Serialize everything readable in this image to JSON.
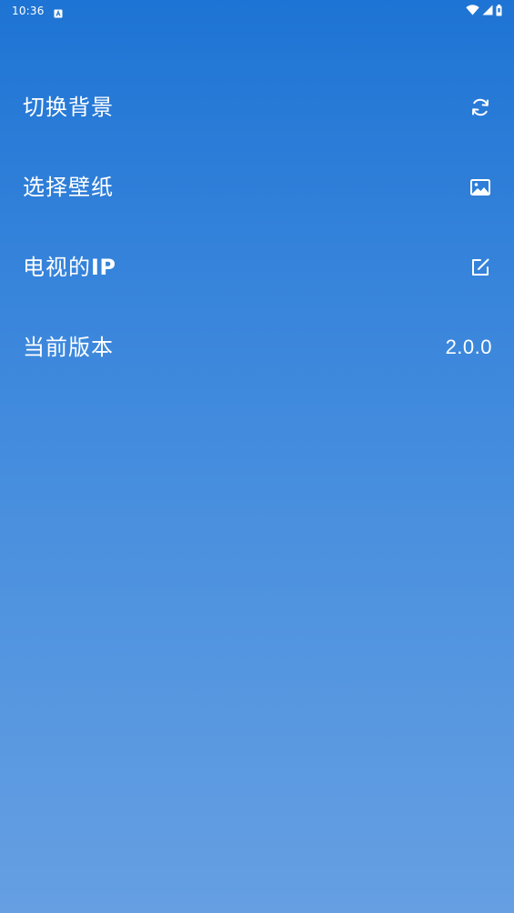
{
  "status_bar": {
    "time": "10:36",
    "notification_icon": "keyboard-a-icon",
    "wifi_icon": "wifi-icon",
    "signal_icon": "cell-signal-icon",
    "battery_icon": "battery-icon"
  },
  "settings": {
    "items": [
      {
        "label": "切换背景",
        "icon": "refresh-icon"
      },
      {
        "label": "选择壁纸",
        "icon": "image-icon"
      },
      {
        "label_prefix": "电视的",
        "label_suffix": "IP",
        "icon": "edit-icon"
      },
      {
        "label": "当前版本",
        "value": "2.0.0"
      }
    ]
  },
  "colors": {
    "gradient_top": "#1e74d4",
    "gradient_bottom": "#669fe2",
    "text": "#ffffff"
  }
}
